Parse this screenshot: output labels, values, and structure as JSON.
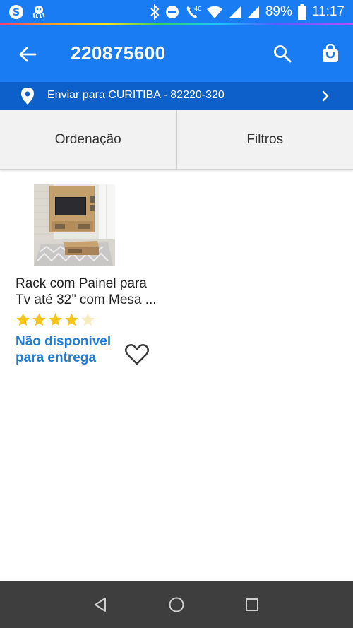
{
  "status_bar": {
    "battery_percent": "89%",
    "time": "11:17",
    "network_label": "4G",
    "icons": [
      "skype-icon",
      "octopus-icon",
      "bluetooth-icon",
      "do-not-disturb-icon",
      "volte-icon",
      "wifi-icon",
      "signal-icon",
      "signal-icon",
      "battery-icon"
    ]
  },
  "app_bar": {
    "title": "220875600",
    "background": "#1a7cf2",
    "icons": [
      "back-arrow-icon",
      "search-icon",
      "shopping-bag-icon"
    ]
  },
  "delivery": {
    "text": "Enviar para CURITIBA - 82220-320",
    "background": "#0d5fc9",
    "icons": [
      "location-pin-icon",
      "chevron-right-icon"
    ]
  },
  "sort_filter": {
    "sort_label": "Ordenação",
    "filter_label": "Filtros"
  },
  "products": [
    {
      "name_line1": "Rack com Painel para",
      "name_line2": "Tv até 32” com Mesa ...",
      "rating": 4,
      "rating_max": 5,
      "availability_line1": "Não disponível",
      "availability_line2": "para entrega",
      "availability_color": "#1f7bd4",
      "star_color": "#f5c518",
      "wishlist_icon": "heart-outline-icon"
    }
  ],
  "nav_bar": {
    "icons": [
      "back-triangle-icon",
      "home-circle-icon",
      "recents-square-icon"
    ]
  }
}
